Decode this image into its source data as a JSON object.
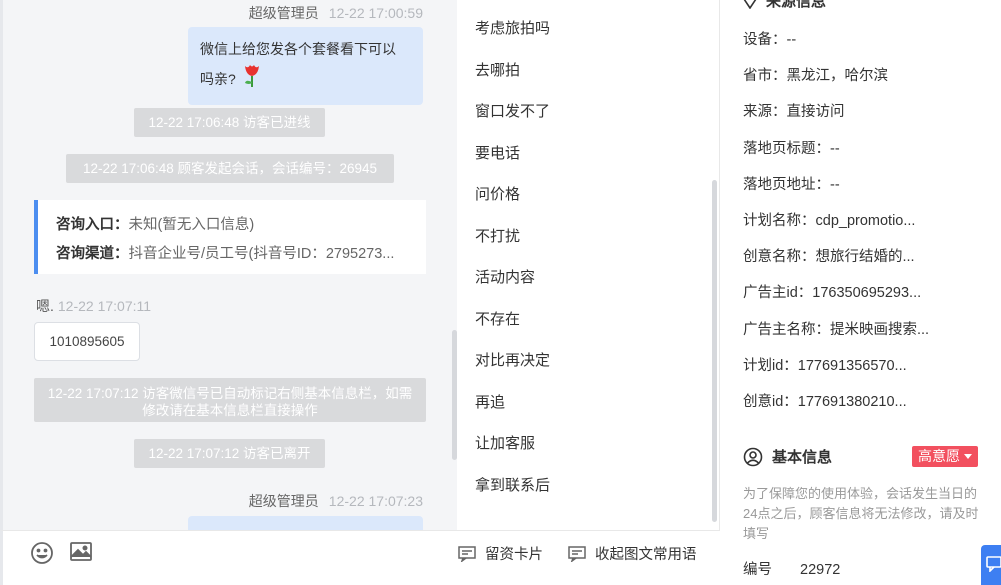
{
  "chat": {
    "messages": [
      {
        "sender": "超级管理员",
        "time": "12-22 17:00:59",
        "text": "微信上给您发各个套餐看下可以",
        "text2": "吗亲?"
      },
      {
        "system": "12-22 17:06:48 访客已进线"
      },
      {
        "system": "12-22 17:06:48 顾客发起会话，会话编号：26945"
      },
      {
        "system": "12-22 17:07:12 访客微信号已自动标记右侧基本信息栏，如需修改请在基本信息栏直接操作"
      },
      {
        "system": "12-22 17:07:12 访客已离开"
      },
      {
        "sender": "超级管理员",
        "time": "12-22 17:07:23"
      }
    ],
    "info_card": {
      "entry_label": "咨询入口：",
      "entry_value": "未知(暂无入口信息)",
      "channel_label": "咨询渠道：",
      "channel_value": "抖音企业号/员工号(抖音号ID：2795273..."
    },
    "visitor": {
      "name": "嗯.",
      "time": "12-22 17:07:11",
      "text": "1010895605"
    }
  },
  "toolbar": {
    "emoji_icon": "emoji-icon",
    "image_icon": "image-icon",
    "lead_card_label": "留资卡片",
    "collapse_phrases_label": "收起图文常用语"
  },
  "phrases": [
    "考虑旅拍吗",
    "去哪拍",
    "窗口发不了",
    "要电话",
    "问价格",
    "不打扰",
    "活动内容",
    "不存在",
    "对比再决定",
    "再追",
    "让加客服",
    "拿到联系后"
  ],
  "source_info": {
    "title": "来源信息",
    "fields": [
      "设备：--",
      "省市：黑龙江，哈尔滨",
      "来源：直接访问",
      "落地页标题：--",
      "落地页地址：--",
      "计划名称：cdp_promotio...",
      "创意名称：想旅行结婚的...",
      "广告主id：176350695293...",
      "广告主名称：提米映画搜索...",
      "计划id：177691356570...",
      "创意id：177691380210..."
    ]
  },
  "basic_info": {
    "title": "基本信息",
    "intent": "高意愿",
    "notice": "为了保障您的使用体验，会话发生当日的24点之后，顾客信息将无法修改，请及时填写",
    "id_label": "编号",
    "id_value": "22972"
  },
  "colors": {
    "bubble": "#dbe8fb",
    "system_bg": "#d9dadc",
    "accent": "#4c8ef0",
    "intent_badge": "#f2505f"
  }
}
